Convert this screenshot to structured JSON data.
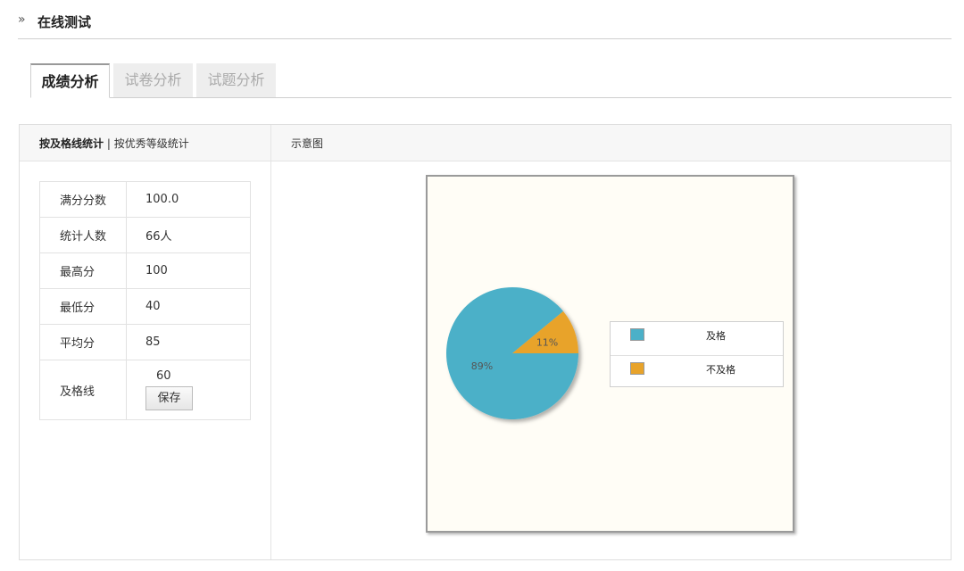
{
  "header": {
    "chevron": "»",
    "title": "在线测试"
  },
  "tabs": [
    {
      "label": "成绩分析",
      "active": true
    },
    {
      "label": "试卷分析",
      "active": false
    },
    {
      "label": "试题分析",
      "active": false
    }
  ],
  "left_panel": {
    "mode_active": "按及格线统计",
    "separator": " | ",
    "mode_inactive": "按优秀等级统计"
  },
  "right_panel": {
    "title": "示意图"
  },
  "stats": {
    "full_score_label": "满分分数",
    "full_score": "100.0",
    "count_label": "统计人数",
    "count": "66人",
    "max_label": "最高分",
    "max": "100",
    "min_label": "最低分",
    "min": "40",
    "avg_label": "平均分",
    "avg": "85",
    "pass_label": "及格线",
    "pass": "60",
    "save_label": "保存"
  },
  "colors": {
    "pass": "#4bb0c8",
    "fail": "#e8a32a"
  },
  "chart_data": {
    "type": "pie",
    "labels": [
      "及格",
      "不及格"
    ],
    "values": [
      89,
      11
    ],
    "value_labels": [
      "89%",
      "11%"
    ],
    "legend_placement": "right"
  }
}
